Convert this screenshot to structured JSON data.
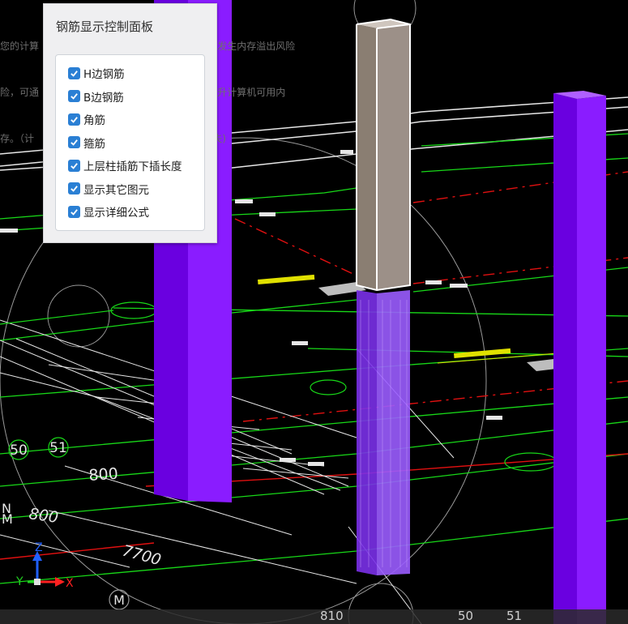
{
  "notice": {
    "lines": [
      "您的计算                                          的内存不足发生内存溢出风险",
      "险，可通                                          据内存来提升计算机可用内",
      "存。（计                                          传后自动消失)"
    ]
  },
  "panel": {
    "title": "钢筋显示控制面板",
    "checkboxes": [
      {
        "label": "H边钢筋",
        "checked": true
      },
      {
        "label": "B边钢筋",
        "checked": true
      },
      {
        "label": "角筋",
        "checked": true
      },
      {
        "label": "箍筋",
        "checked": true
      },
      {
        "label": "上层柱插筋下插长度",
        "checked": true
      },
      {
        "label": "显示其它图元",
        "checked": true
      },
      {
        "label": "显示详细公式",
        "checked": true
      }
    ]
  },
  "scene": {
    "axis_labels": {
      "a": "50",
      "b": "51",
      "c": "M"
    },
    "dimensions": {
      "d1": "800",
      "d2": "800",
      "d3": "7700",
      "d4": "N",
      "d5": "M"
    },
    "bottom_labels": {
      "a": "810",
      "b": "50",
      "c": "51"
    },
    "gizmo": {
      "x": "X",
      "y": "Y",
      "z": "Z"
    },
    "colors": {
      "column_purple": "#7a00f0",
      "grid_green": "#18d818",
      "axis_red": "#e01010",
      "line_white": "#e6e6e6",
      "accent_yellow": "#e0e000"
    }
  }
}
